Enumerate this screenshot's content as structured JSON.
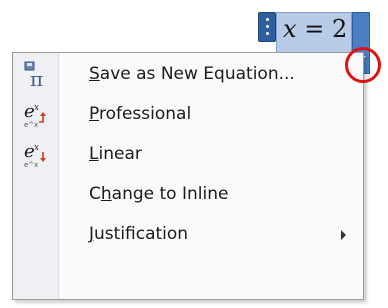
{
  "equation": {
    "var": "x",
    "eq": "=",
    "num": "2"
  },
  "menu": {
    "items": [
      {
        "pre": "",
        "key": "S",
        "post": "ave as New Equation...",
        "icon": "pi-equation-icon"
      },
      {
        "pre": "",
        "key": "P",
        "post": "rofessional",
        "icon": "professional-format-icon"
      },
      {
        "pre": "",
        "key": "L",
        "post": "inear",
        "icon": "linear-format-icon"
      },
      {
        "pre": "C",
        "key": "h",
        "post": "ange to Inline",
        "icon": ""
      },
      {
        "pre": "",
        "key": "J",
        "post": "ustification",
        "icon": ""
      }
    ]
  },
  "colors": {
    "highlight": "#e01010",
    "equation_bg": "#b7cbe6",
    "dropdown_bg": "#4a7fc4"
  }
}
